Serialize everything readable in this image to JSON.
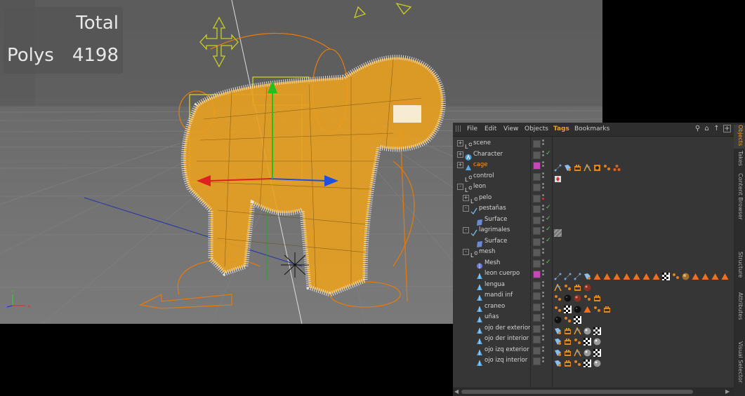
{
  "viewport": {
    "hud": {
      "total_label": "Total",
      "polys_label": "Polys",
      "polys_value": "4198"
    },
    "axis_labels": {
      "x": "X",
      "y": "Y",
      "z": "Z"
    }
  },
  "object_manager": {
    "menu": [
      "File",
      "Edit",
      "View",
      "Objects",
      "Tags",
      "Bookmarks"
    ],
    "active_menu": "Tags",
    "toolbar_icons": [
      "search-icon",
      "home-icon",
      "up-icon",
      "new-view-icon"
    ],
    "side_tabs": [
      "Objects",
      "Takes",
      "Content Browser",
      "Structure",
      "Attributes",
      "Visual Selector"
    ],
    "active_side_tab": "Objects",
    "rows": [
      {
        "name": "scene",
        "indent": 0,
        "expander": "+",
        "icon": "null-icon",
        "layer": "none",
        "vis": "grey",
        "check": false,
        "tags": []
      },
      {
        "name": "Character",
        "indent": 0,
        "expander": "+",
        "icon": "character-icon",
        "layer": "none",
        "vis": "grey",
        "check": true,
        "tags": []
      },
      {
        "name": "cage",
        "indent": 0,
        "expander": "+",
        "icon": "joint-icon",
        "layer": "pink",
        "vis": "grey",
        "check": false,
        "selected": true,
        "tags": [
          "ik-tag",
          "weight-tag",
          "texture-tag",
          "motion-tag",
          "constraint-tag",
          "dots-tag",
          "pose-tag"
        ]
      },
      {
        "name": "control",
        "indent": 0,
        "expander": "",
        "icon": "null-icon",
        "layer": "none",
        "vis": "grey",
        "check": false,
        "tags": [
          "protection-tag"
        ]
      },
      {
        "name": "leon",
        "indent": 0,
        "expander": "-",
        "icon": "null-icon",
        "layer": "none",
        "vis": "grey",
        "check": false,
        "tags": []
      },
      {
        "name": "pelo",
        "indent": 1,
        "expander": "+",
        "icon": "null-icon",
        "layer": "none",
        "vis": "red",
        "check": false,
        "tags": []
      },
      {
        "name": "pestañas",
        "indent": 1,
        "expander": "-",
        "icon": "hair-icon",
        "layer": "none",
        "vis": "grey",
        "check": true,
        "tags": []
      },
      {
        "name": "Surface",
        "indent": 2,
        "expander": "",
        "icon": "surface-icon",
        "layer": "none",
        "vis": "grey",
        "check": true,
        "tags": []
      },
      {
        "name": "lagrimales",
        "indent": 1,
        "expander": "-",
        "icon": "hair-icon",
        "layer": "none",
        "vis": "grey",
        "check": true,
        "tags": [
          "hatch-tag"
        ]
      },
      {
        "name": "Surface",
        "indent": 2,
        "expander": "",
        "icon": "surface-icon",
        "layer": "none",
        "vis": "grey",
        "check": true,
        "tags": []
      },
      {
        "name": "mesh",
        "indent": 1,
        "expander": "-",
        "icon": "null-icon",
        "layer": "none",
        "vis": "grey",
        "check": false,
        "tags": []
      },
      {
        "name": "Mesh",
        "indent": 2,
        "expander": "",
        "icon": "mesh-icon",
        "layer": "none",
        "vis": "grey",
        "check": true,
        "tags": []
      },
      {
        "name": "leon cuerpo",
        "indent": 2,
        "expander": "",
        "icon": "poly-icon",
        "layer": "pink",
        "vis": "grey",
        "check": false,
        "tags": [
          "ik-tag",
          "ik-tag",
          "ik-tag",
          "weight-tag",
          "tri-tag",
          "tri-tag",
          "tri-tag",
          "tri-tag",
          "tri-tag",
          "tri-tag",
          "tri-tag",
          "checker-tag",
          "dots-tag",
          "fur-tag",
          "tri-tag",
          "tri-tag",
          "tri-tag",
          "tri-tag"
        ]
      },
      {
        "name": "lengua",
        "indent": 2,
        "expander": "",
        "icon": "poly-icon",
        "layer": "none",
        "vis": "grey",
        "check": false,
        "tags": [
          "motion-tag",
          "dots-tag",
          "texture-tag",
          "sphere-tag"
        ]
      },
      {
        "name": "mandi inf",
        "indent": 2,
        "expander": "",
        "icon": "poly-icon",
        "layer": "none",
        "vis": "grey",
        "check": false,
        "tags": [
          "dots-tag",
          "dark-sphere-tag",
          "sphere-tag",
          "dots-tag",
          "texture-tag"
        ]
      },
      {
        "name": "craneo",
        "indent": 2,
        "expander": "",
        "icon": "poly-icon",
        "layer": "none",
        "vis": "grey",
        "check": false,
        "tags": [
          "dots-tag",
          "checker-tag",
          "dark-sphere-tag",
          "tri-tag",
          "dots-tag",
          "texture-tag"
        ]
      },
      {
        "name": "uñas",
        "indent": 2,
        "expander": "",
        "icon": "poly-icon",
        "layer": "none",
        "vis": "grey",
        "check": false,
        "tags": [
          "dark-sphere-tag",
          "dots-tag",
          "checker-tag"
        ]
      },
      {
        "name": "ojo der exterior",
        "indent": 2,
        "expander": "",
        "icon": "poly-icon",
        "layer": "none",
        "vis": "grey",
        "check": false,
        "tags": [
          "weight-tag",
          "texture-tag",
          "motion-tag",
          "grey-sphere-tag",
          "checker-tag"
        ]
      },
      {
        "name": "ojo der interior",
        "indent": 2,
        "expander": "",
        "icon": "poly-icon",
        "layer": "none",
        "vis": "grey",
        "check": false,
        "tags": [
          "weight-tag",
          "texture-tag",
          "dots-tag",
          "checker-tag",
          "grey-sphere-tag"
        ]
      },
      {
        "name": "ojo izq exterior",
        "indent": 2,
        "expander": "",
        "icon": "poly-icon",
        "layer": "none",
        "vis": "grey",
        "check": false,
        "tags": [
          "weight-tag",
          "texture-tag",
          "motion-tag",
          "grey-sphere-tag",
          "checker-tag"
        ]
      },
      {
        "name": "ojo izq interior",
        "indent": 2,
        "expander": "",
        "icon": "poly-icon",
        "layer": "none",
        "vis": "grey",
        "check": false,
        "tags": [
          "weight-tag",
          "texture-tag",
          "dots-tag",
          "checker-tag",
          "grey-sphere-tag"
        ]
      }
    ]
  },
  "colors": {
    "accent": "#f0a020",
    "selected_text": "#ff9a1a",
    "check_green": "#5ccc5c",
    "layer_pink": "#c648b8",
    "tag_orange": "#f07020"
  }
}
